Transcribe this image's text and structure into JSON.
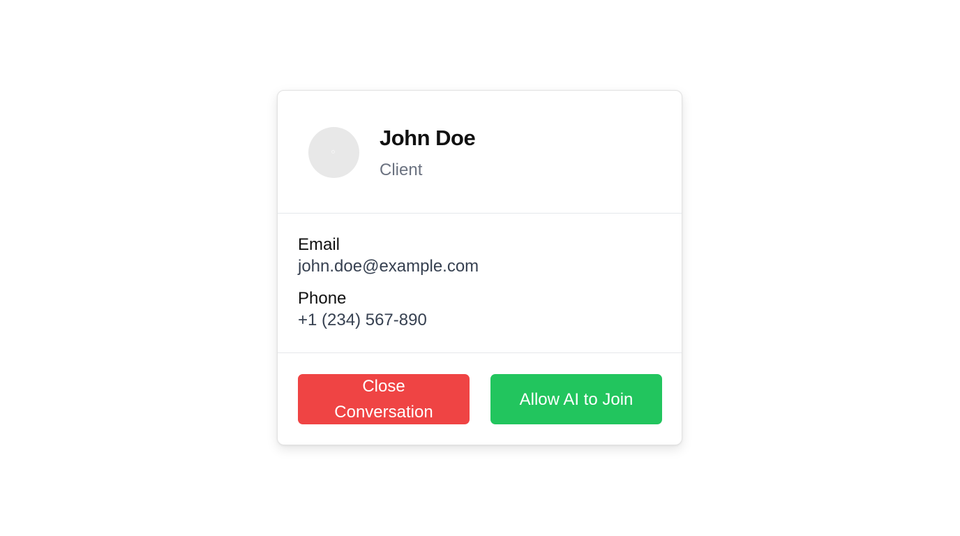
{
  "contact": {
    "name": "John Doe",
    "role": "Client",
    "avatar_icon": "user-avatar-icon"
  },
  "details": {
    "email_label": "Email",
    "email_value": "john.doe@example.com",
    "phone_label": "Phone",
    "phone_value": "+1 (234) 567-890"
  },
  "actions": {
    "close_label": "Close Conversation",
    "allow_label": "Allow AI to Join"
  },
  "colors": {
    "danger": "#ef4444",
    "success": "#22c55e",
    "muted_text": "#6b7280",
    "value_text": "#374151",
    "avatar_bg": "#e8e8e8"
  }
}
